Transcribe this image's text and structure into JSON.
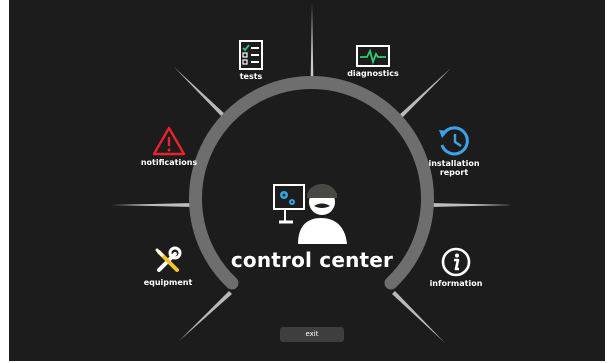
{
  "menu": {
    "tests": "tests",
    "diagnostics": "diagnostics",
    "notifications": "notifications",
    "installation_line1": "installation",
    "installation_line2": "report",
    "equipment": "equipment",
    "information": "information"
  },
  "center": {
    "title": "control center"
  },
  "footer": {
    "exit_label": "exit"
  },
  "icons": {
    "tests": "checklist-icon",
    "diagnostics": "heartbeat-monitor-icon",
    "notifications": "warning-triangle-icon",
    "installation": "history-clock-icon",
    "equipment": "wrench-screwdriver-icon",
    "information": "info-icon",
    "center": "technician-icon"
  },
  "colors": {
    "background": "#1c1c1c",
    "arc": "#6e6e6e",
    "warning": "#e8232a",
    "diagnostics": "#2ecc71",
    "installation": "#3ba3e8",
    "gear": "#2fa8e0"
  }
}
